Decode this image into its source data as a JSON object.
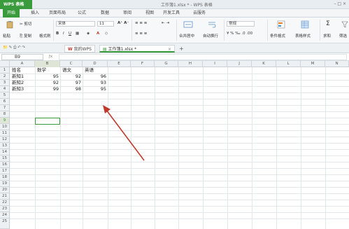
{
  "app": {
    "name": "WPS 表格",
    "doc_title": "工作簿1.xlsx * - WPS 表格",
    "window_controls": "– □ ×"
  },
  "ribbon_tabs": [
    "开始",
    "插入",
    "页面布局",
    "公式",
    "数据",
    "审阅",
    "视图",
    "开发工具",
    "云服务"
  ],
  "toolbar": {
    "paste": "粘贴",
    "cut": "剪切",
    "copy": "复制",
    "format_painter": "格式刷",
    "font_name": "宋体",
    "font_size": "11",
    "merge_center": "合并居中",
    "auto_wrap": "自动换行",
    "number_format": "常规",
    "conditional_format": "条件格式",
    "table_style": "表格样式",
    "sum": "求和",
    "filter": "筛选"
  },
  "doc_tabs": {
    "home": "我的WPS",
    "active": "工作簿1.xlsx *",
    "add": "+"
  },
  "name_box": "B9",
  "columns": [
    "A",
    "B",
    "C",
    "D",
    "E",
    "F",
    "G",
    "H",
    "I",
    "J",
    "K",
    "L",
    "M",
    "N"
  ],
  "rows": [
    "1",
    "2",
    "3",
    "4",
    "5",
    "6",
    "7",
    "8",
    "9",
    "10",
    "11",
    "12",
    "13",
    "14",
    "15",
    "16",
    "17",
    "18",
    "19",
    "20",
    "21",
    "22",
    "23",
    "24",
    "25"
  ],
  "sheet": {
    "headers": [
      "姓名",
      "数学",
      "语文",
      "英语"
    ],
    "data": [
      [
        "新知1",
        "95",
        "92",
        "96"
      ],
      [
        "新知2",
        "92",
        "97",
        "93"
      ],
      [
        "新知3",
        "99",
        "98",
        "95"
      ]
    ]
  },
  "annotation_color": "#c0392b"
}
